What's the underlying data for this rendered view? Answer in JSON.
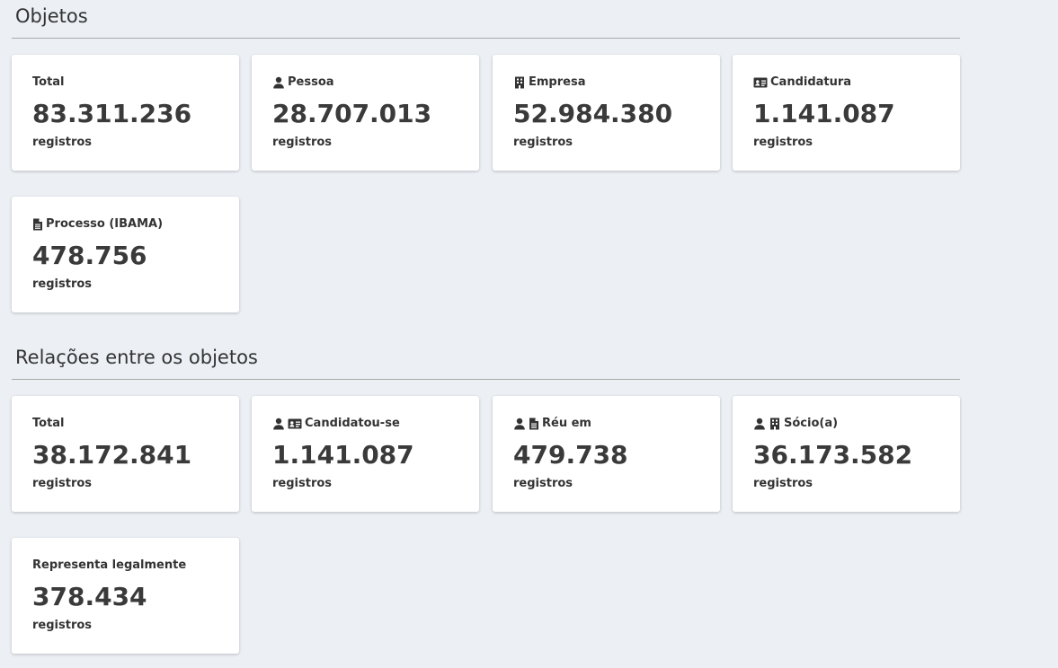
{
  "objects": {
    "title": "Objetos",
    "cards": [
      {
        "label": "Total",
        "value": "83.311.236",
        "unit": "registros",
        "icons": []
      },
      {
        "label": "Pessoa",
        "value": "28.707.013",
        "unit": "registros",
        "icons": [
          "person-icon"
        ]
      },
      {
        "label": "Empresa",
        "value": "52.984.380",
        "unit": "registros",
        "icons": [
          "building-icon"
        ]
      },
      {
        "label": "Candidatura",
        "value": "1.141.087",
        "unit": "registros",
        "icons": [
          "id-card-icon"
        ]
      },
      {
        "label": "Processo (IBAMA)",
        "value": "478.756",
        "unit": "registros",
        "icons": [
          "document-icon"
        ]
      }
    ]
  },
  "relations": {
    "title": "Relações entre os objetos",
    "cards": [
      {
        "label": "Total",
        "value": "38.172.841",
        "unit": "registros",
        "icons": []
      },
      {
        "label": "Candidatou-se",
        "value": "1.141.087",
        "unit": "registros",
        "icons": [
          "person-icon",
          "id-card-icon"
        ]
      },
      {
        "label": "Réu em",
        "value": "479.738",
        "unit": "registros",
        "icons": [
          "person-icon",
          "document-icon"
        ]
      },
      {
        "label": "Sócio(a)",
        "value": "36.173.582",
        "unit": "registros",
        "icons": [
          "person-icon",
          "building-icon"
        ]
      },
      {
        "label": "Representa legalmente",
        "value": "378.434",
        "unit": "registros",
        "icons": []
      }
    ]
  }
}
